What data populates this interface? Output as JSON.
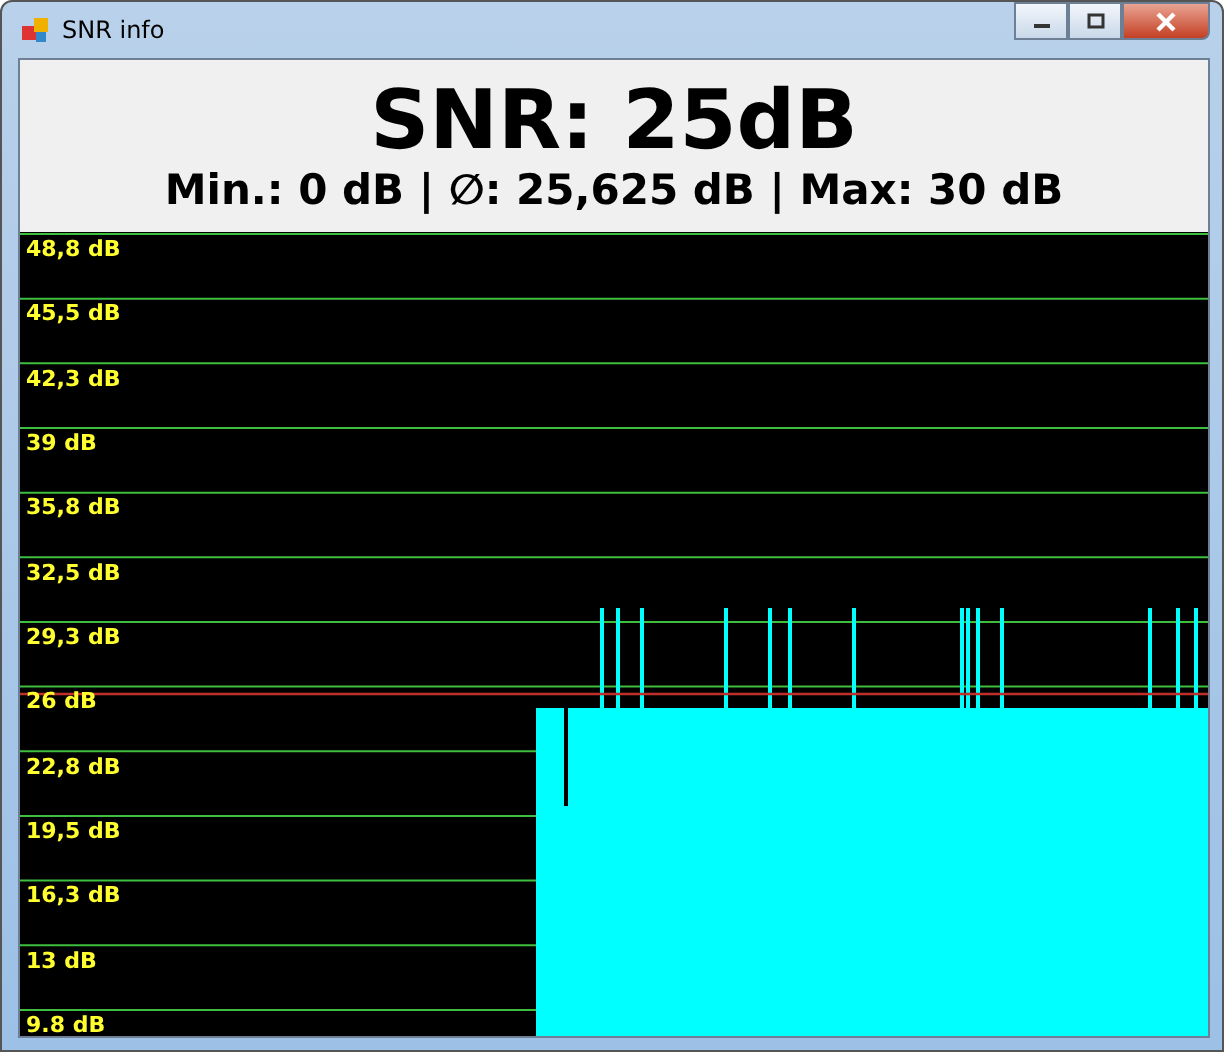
{
  "window": {
    "title": "SNR info"
  },
  "snr": "SNR: 25dB",
  "stats": "Min.: 0 dB | ∅: 25,625 dB | Max: 30 dB",
  "graph": {
    "y_labels": [
      "48,8 dB",
      "45,5 dB",
      "42,3 dB",
      "39 dB",
      "35,8 dB",
      "32,5 dB",
      "29,3 dB",
      "26 dB",
      "22,8 dB",
      "19,5 dB",
      "16,3 dB",
      "13 dB",
      "9.8 dB"
    ]
  }
}
